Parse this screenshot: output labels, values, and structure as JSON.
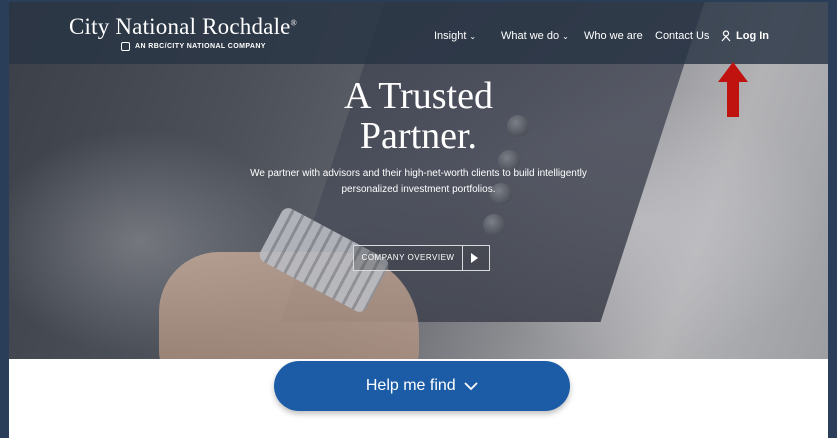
{
  "header": {
    "brand_title": "City National Rochdale",
    "brand_trademark": "®",
    "brand_subtitle": "AN RBC/CITY NATIONAL COMPANY",
    "nav": [
      {
        "label": "Insight",
        "has_dropdown": true
      },
      {
        "label": "What we do",
        "has_dropdown": true
      },
      {
        "label": "Who we are",
        "has_dropdown": false
      },
      {
        "label": "Contact Us",
        "has_dropdown": false
      },
      {
        "label": "Log In",
        "icon": "user-icon"
      }
    ]
  },
  "hero": {
    "headline_line1": "A Trusted",
    "headline_line2": "Partner.",
    "subtext_line1": "We partner with advisors and their high-net-worth clients to build intelligently",
    "subtext_line2": "personalized investment portfolios.",
    "cta_label": "COMPANY OVERVIEW",
    "cta_icon": "play-icon"
  },
  "help": {
    "label": "Help me find",
    "icon": "chevron-down-icon"
  },
  "annotation": {
    "icon": "red-up-arrow",
    "color": "#c0120f"
  },
  "colors": {
    "navbar": "#2b3a4e",
    "help_button": "#1c5ca6",
    "frame": "#2b3e59"
  }
}
